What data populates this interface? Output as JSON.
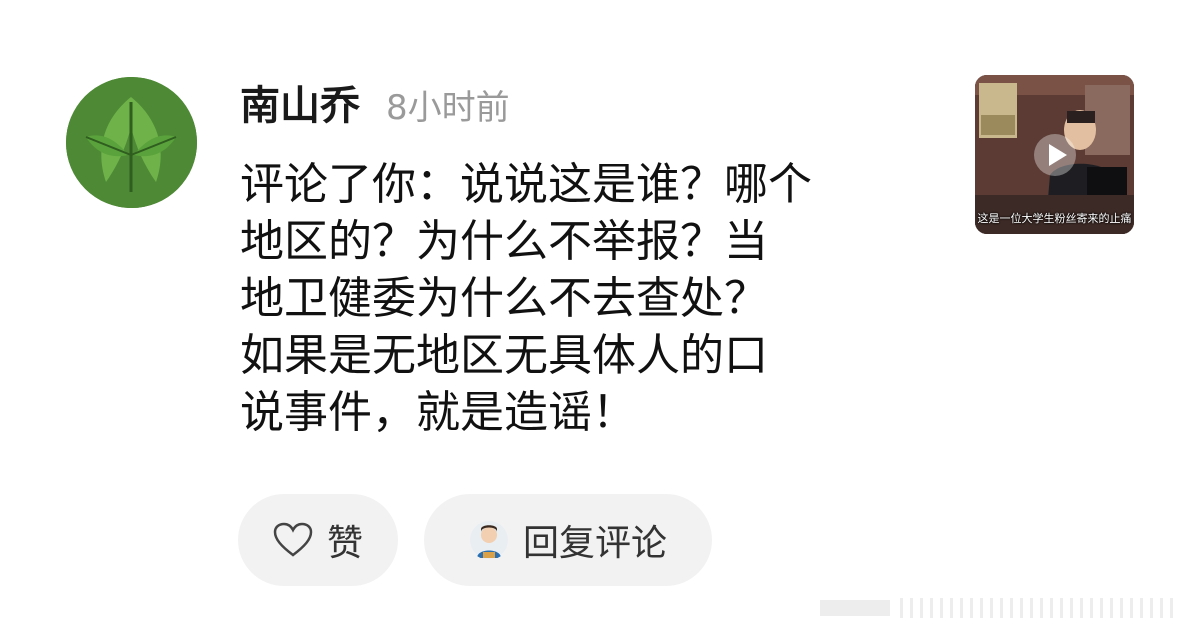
{
  "comment": {
    "author": "南山乔",
    "time": "8小时前",
    "lines": [
      "评论了你：说说这是谁？哪个",
      "地区的？为什么不举报？当",
      "地卫健委为什么不去查处？",
      "如果是无地区无具体人的口",
      "说事件，就是造谣！"
    ]
  },
  "video_thumb": {
    "caption": "这是一位大学生粉丝寄来的止痛"
  },
  "actions": {
    "like_label": "赞",
    "reply_label": "回复评论"
  },
  "icons": {
    "like": "heart-outline-icon",
    "play": "play-icon"
  },
  "colors": {
    "button_bg": "#f2f2f2",
    "time_gray": "#9a9a9a",
    "text_dark": "#111111"
  }
}
